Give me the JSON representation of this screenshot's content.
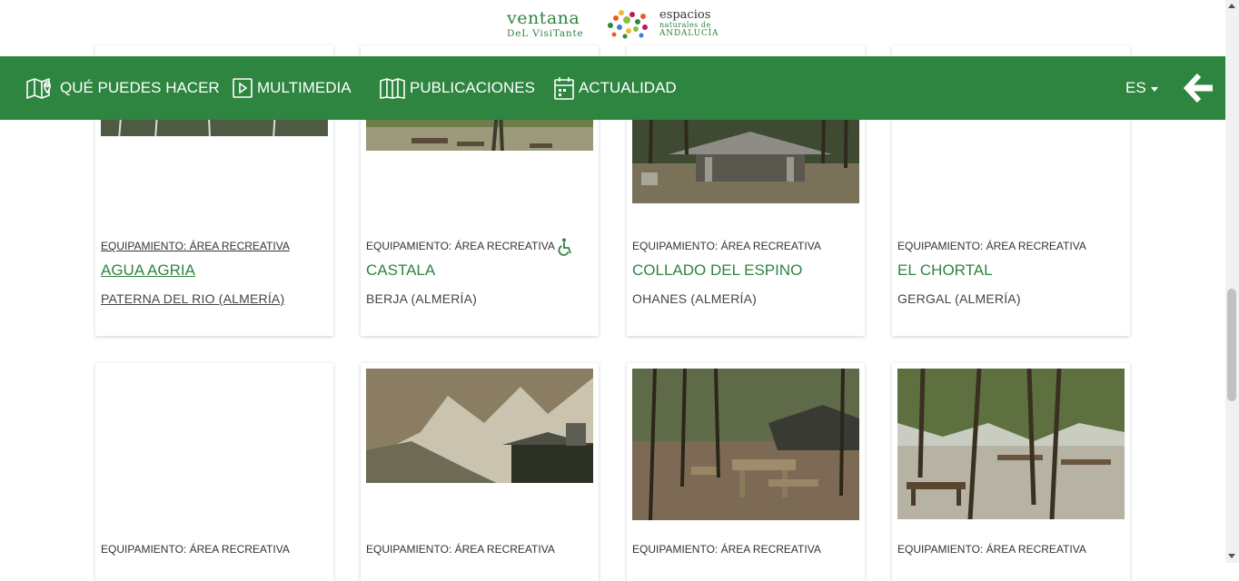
{
  "header": {
    "logo_line1": "ventana",
    "logo_line2": "DeL VisiTante",
    "logo_right1": "espacios",
    "logo_right2": "naturales de",
    "logo_right3": "ANDALUCÍA"
  },
  "nav": {
    "items": [
      {
        "label": "QUÉ PUEDES HACER",
        "icon": "map-pin-icon"
      },
      {
        "label": "MULTIMEDIA",
        "icon": "play-icon"
      },
      {
        "label": "PUBLICACIONES",
        "icon": "book-icon"
      },
      {
        "label": "ACTUALIDAD",
        "icon": "calendar-icon"
      }
    ],
    "language": "ES",
    "back_icon": "back-arrow-icon"
  },
  "cards_row1": [
    {
      "type": "EQUIPAMIENTO: ÁREA RECREATIVA",
      "name": "AGUA AGRIA",
      "location": "PATERNA DEL RIO (ALMERÍA)"
    },
    {
      "type": "EQUIPAMIENTO: ÁREA RECREATIVA",
      "name": "CASTALA",
      "location": "BERJA (ALMERÍA)",
      "accessible": "wheelchair-icon"
    },
    {
      "type": "EQUIPAMIENTO: ÁREA RECREATIVA",
      "name": "COLLADO DEL ESPINO",
      "location": "OHANES (ALMERÍA)"
    },
    {
      "type": "EQUIPAMIENTO: ÁREA RECREATIVA",
      "name": "EL CHORTAL",
      "location": "GERGAL (ALMERÍA)"
    }
  ],
  "cards_row2": [
    {
      "type": "EQUIPAMIENTO: ÁREA RECREATIVA"
    },
    {
      "type": "EQUIPAMIENTO: ÁREA RECREATIVA"
    },
    {
      "type": "EQUIPAMIENTO: ÁREA RECREATIVA"
    },
    {
      "type": "EQUIPAMIENTO: ÁREA RECREATIVA"
    }
  ],
  "colors": {
    "brand_green": "#2e8540",
    "text": "#333333"
  }
}
